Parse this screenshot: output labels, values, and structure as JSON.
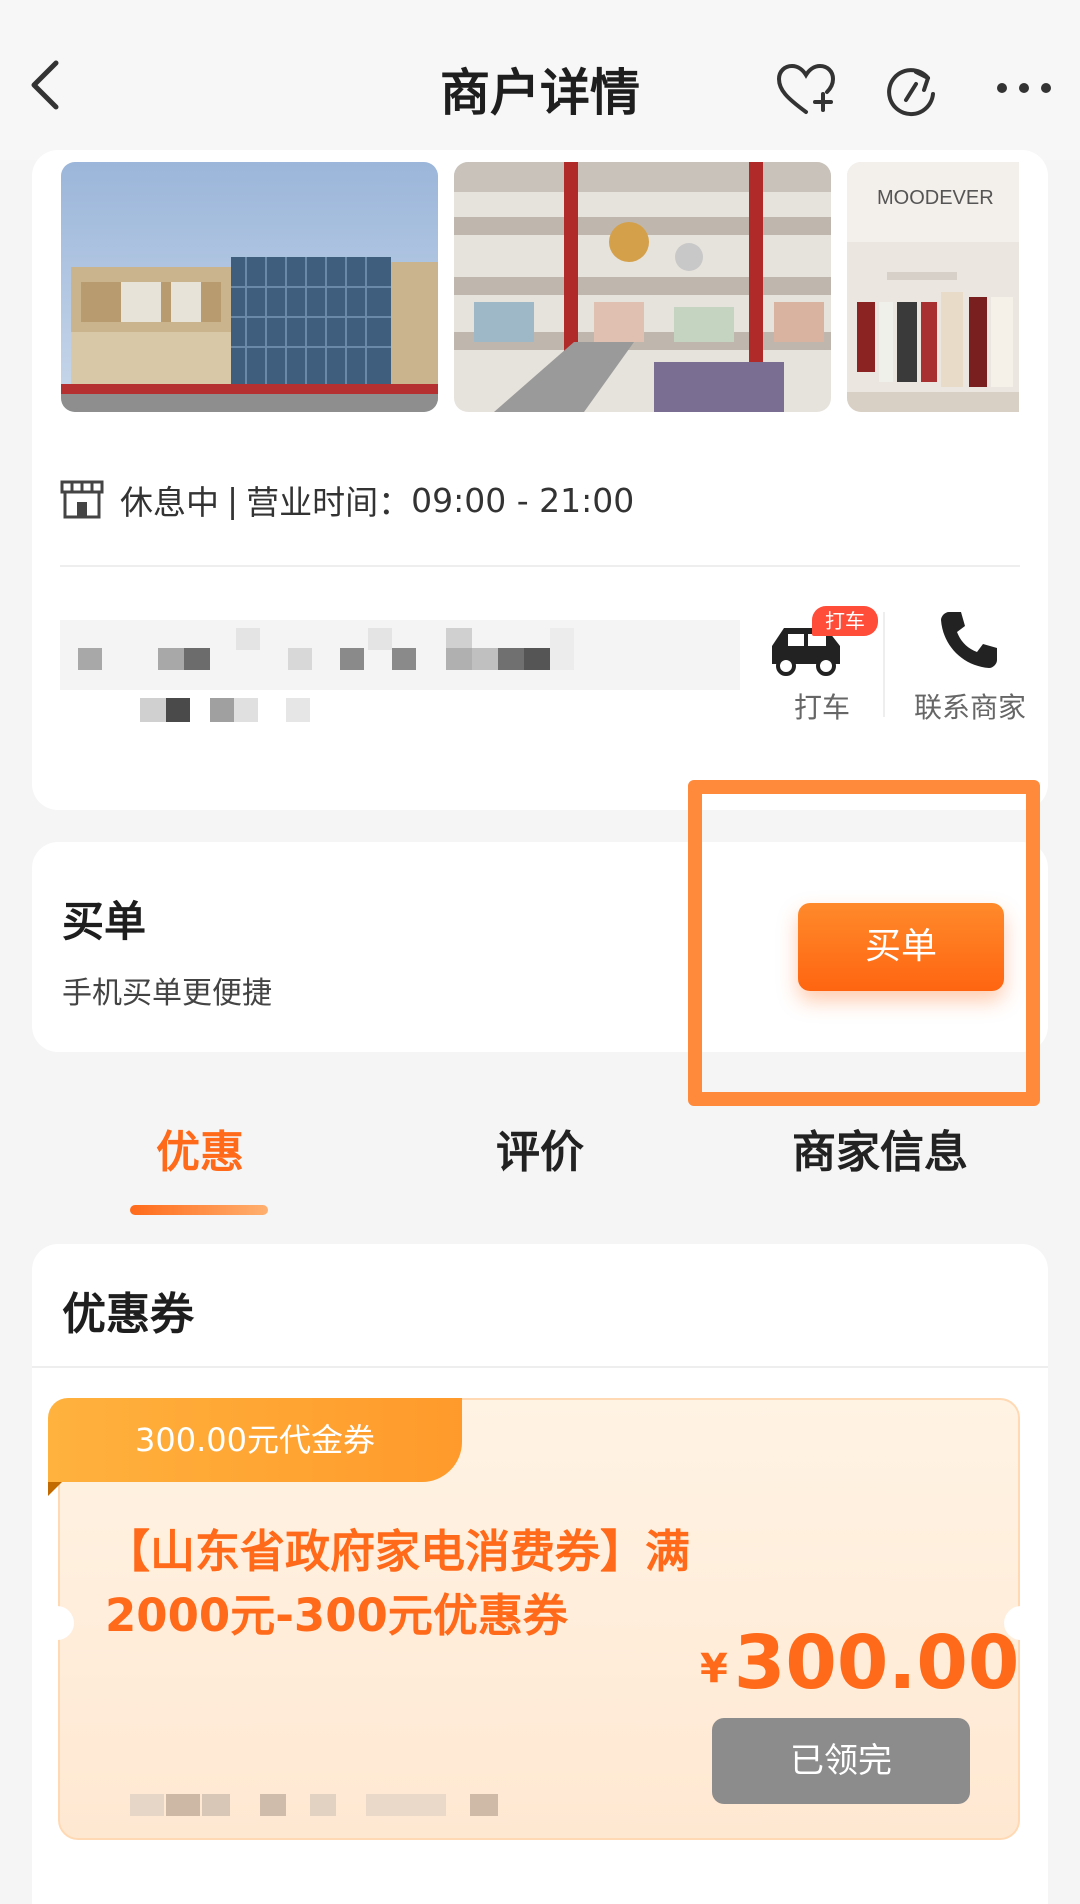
{
  "header": {
    "title": "商户详情"
  },
  "store": {
    "status": "休息中",
    "hours_label": "营业时间：",
    "hours": "09:00 - 21:00",
    "taxi_label": "打车",
    "taxi_badge": "打车",
    "contact_label": "联系商家",
    "photo_texts": [
      "MOODEVER"
    ]
  },
  "buy": {
    "title": "买单",
    "subtitle": "手机买单更便捷",
    "button_label": "买单"
  },
  "tabs": [
    {
      "label": "优惠",
      "active": true
    },
    {
      "label": "评价",
      "active": false
    },
    {
      "label": "商家信息",
      "active": false
    }
  ],
  "coupons": {
    "section_title": "优惠券",
    "items": [
      {
        "tag": "300.00元代金券",
        "name": "【山东省政府家电消费券】满2000元-300元优惠券",
        "currency": "¥",
        "amount": "300.00",
        "button_label": "已领完"
      }
    ]
  },
  "colors": {
    "accent": "#ff6a1a",
    "button_gradient_start": "#ff8a2b",
    "button_gradient_end": "#ff6510",
    "highlight_box": "#ff8a3c",
    "claimed_button": "#8c8c8c"
  },
  "icons": [
    "back-icon",
    "favorite-add-icon",
    "share-icon",
    "more-icon",
    "store-icon",
    "taxi-icon",
    "phone-icon"
  ]
}
